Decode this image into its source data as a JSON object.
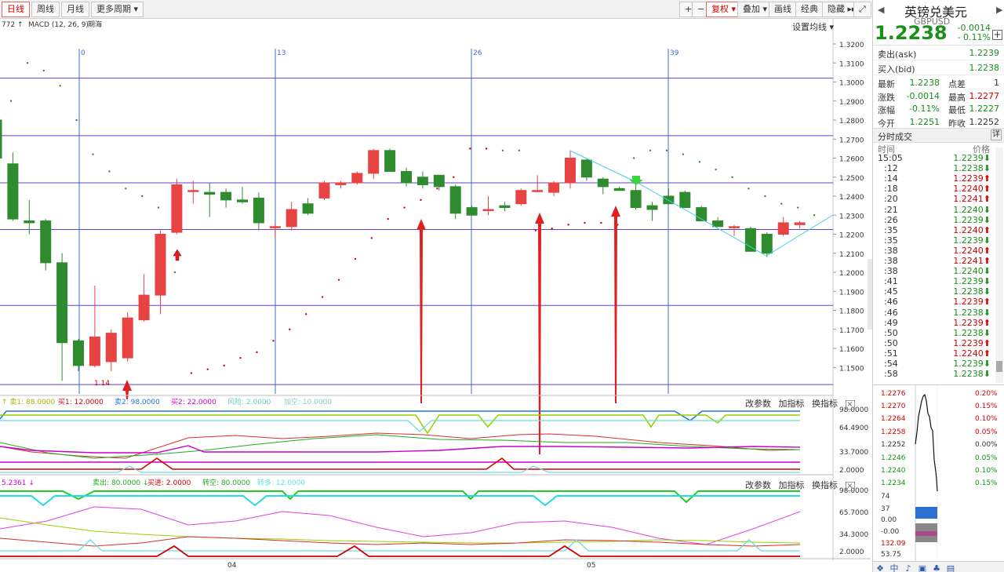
{
  "toolbar": {
    "left_tabs": [
      "日线",
      "周线",
      "月线",
      "更多周期 ▾"
    ],
    "right_buttons": [
      "+",
      "−",
      "复权 ▾",
      "叠加 ▾",
      "画线",
      "经典",
      "隐藏 ▸▸",
      "⤢"
    ]
  },
  "main_panel": {
    "indicator_tag": "772 ↑",
    "macd_label": "MACD (12, 26, 9)",
    "extra_label": "期海",
    "settings_label": "设置均线 ▾",
    "month_labels": [
      "0",
      "13",
      "26",
      "39"
    ],
    "y_ticks": [
      "1.3200",
      "1.3100",
      "1.3000",
      "1.2900",
      "1.2800",
      "1.2700",
      "1.2600",
      "1.2500",
      "1.2400",
      "1.2300",
      "1.2200",
      "1.2100",
      "1.2000",
      "1.1900",
      "1.1800",
      "1.1700",
      "1.1600",
      "1.1500"
    ],
    "low_marker": "1.14"
  },
  "panel2": {
    "legend": [
      {
        "text": "↑ 卖1: 88.0000",
        "color": "#b0b000"
      },
      {
        "text": "买1: 12.0000",
        "color": "#d40000"
      },
      {
        "text": "卖2: 98.0000",
        "color": "#2277dd"
      },
      {
        "text": "买2: 22.0000",
        "color": "#cc00cc"
      },
      {
        "text": "风险: 2.0000",
        "color": "#66cccc"
      },
      {
        "text": "加空: 10.0000",
        "color": "#88cccc"
      }
    ],
    "tools": [
      "改参数",
      "加指标",
      "换指标"
    ],
    "y_ticks": [
      "98.0000",
      "64.4900",
      "33.7000",
      "2.0000"
    ]
  },
  "panel3": {
    "left_value": "5.2361 ↓",
    "legend": [
      {
        "text": "卖出: 80.0000 ↓",
        "color": "#22aa22"
      },
      {
        "text": "买进: 2.0000",
        "color": "#d40000"
      },
      {
        "text": "转空: 80.0000",
        "color": "#22aa22"
      },
      {
        "text": "转多: 12.0000",
        "color": "#66dddd"
      }
    ],
    "tools": [
      "改参数",
      "加指标",
      "换指标"
    ],
    "y_ticks": [
      "98.0000",
      "65.7000",
      "34.3000",
      "2.0000"
    ]
  },
  "x_axis_labels": [
    "04",
    "05"
  ],
  "side": {
    "nav_left": "◀",
    "nav_right": "▶",
    "title": "英镑兑美元",
    "code": "GBPUSD",
    "price": "1.2238",
    "change": "-0.0014",
    "change_pct": "- 0.11%",
    "plus": "+",
    "ask_label": "卖出(ask)",
    "ask_value": "1.2239",
    "bid_label": "买入(bid)",
    "bid_value": "1.2238",
    "quote": [
      [
        "最新",
        "1.2238",
        "点差",
        "1"
      ],
      [
        "涨跌",
        "-0.0014",
        "最高",
        "1.2277"
      ],
      [
        "涨幅",
        "-0.11%",
        "最低",
        "1.2227"
      ],
      [
        "今开",
        "1.2251",
        "昨收",
        "1.2252"
      ]
    ],
    "ticks_title": "分时成交",
    "ticks_detail": "详",
    "col_time": "时间",
    "col_price": "价格",
    "ticks": [
      [
        "15:05",
        "1.2239",
        "down"
      ],
      [
        ":12",
        "1.2238",
        "down"
      ],
      [
        ":14",
        "1.2239",
        "up"
      ],
      [
        ":18",
        "1.2240",
        "up"
      ],
      [
        ":20",
        "1.2241",
        "up"
      ],
      [
        ":21",
        "1.2240",
        "down"
      ],
      [
        ":26",
        "1.2239",
        "down"
      ],
      [
        ":35",
        "1.2240",
        "up"
      ],
      [
        ":35",
        "1.2239",
        "down"
      ],
      [
        ":38",
        "1.2240",
        "up"
      ],
      [
        ":38",
        "1.2241",
        "up"
      ],
      [
        ":38",
        "1.2240",
        "down"
      ],
      [
        ":41",
        "1.2239",
        "down"
      ],
      [
        ":45",
        "1.2238",
        "down"
      ],
      [
        ":46",
        "1.2239",
        "up"
      ],
      [
        ":46",
        "1.2238",
        "down"
      ],
      [
        ":49",
        "1.2239",
        "up"
      ],
      [
        ":50",
        "1.2238",
        "down"
      ],
      [
        ":50",
        "1.2239",
        "up"
      ],
      [
        ":51",
        "1.2240",
        "up"
      ],
      [
        ":54",
        "1.2239",
        "down"
      ],
      [
        ":58",
        "1.2238",
        "down"
      ]
    ],
    "mini_left": [
      "1.2276",
      "1.2270",
      "1.2264",
      "1.2258",
      "1.2252",
      "1.2246",
      "1.2240",
      "1.2234",
      "74",
      "37",
      "0.00",
      "-0.00",
      "132.09",
      "53.75"
    ],
    "mini_right": [
      "0.20%",
      "0.15%",
      "0.10%",
      "0.05%",
      "0.00%",
      "0.05%",
      "0.10%",
      "0.15%"
    ],
    "bottom_icons": [
      "❖",
      "中",
      "♪",
      "▣",
      "♣",
      "▤"
    ]
  },
  "chart_data": {
    "type": "candlestick",
    "symbol": "GBPUSD",
    "ylim": [
      1.14,
      1.325
    ],
    "candles": [
      {
        "o": 1.28,
        "h": 1.288,
        "l": 1.258,
        "c": 1.26
      },
      {
        "o": 1.257,
        "h": 1.263,
        "l": 1.227,
        "c": 1.228
      },
      {
        "o": 1.227,
        "h": 1.238,
        "l": 1.22,
        "c": 1.226
      },
      {
        "o": 1.227,
        "h": 1.228,
        "l": 1.201,
        "c": 1.205
      },
      {
        "o": 1.205,
        "h": 1.21,
        "l": 1.143,
        "c": 1.163
      },
      {
        "o": 1.164,
        "h": 1.165,
        "l": 1.148,
        "c": 1.151
      },
      {
        "o": 1.151,
        "h": 1.193,
        "l": 1.15,
        "c": 1.166
      },
      {
        "o": 1.153,
        "h": 1.17,
        "l": 1.148,
        "c": 1.168
      },
      {
        "o": 1.155,
        "h": 1.179,
        "l": 1.153,
        "c": 1.176
      },
      {
        "o": 1.175,
        "h": 1.199,
        "l": 1.174,
        "c": 1.188
      },
      {
        "o": 1.188,
        "h": 1.222,
        "l": 1.178,
        "c": 1.22
      },
      {
        "o": 1.221,
        "h": 1.249,
        "l": 1.22,
        "c": 1.246
      },
      {
        "o": 1.243,
        "h": 1.248,
        "l": 1.236,
        "c": 1.243
      },
      {
        "o": 1.242,
        "h": 1.247,
        "l": 1.229,
        "c": 1.241
      },
      {
        "o": 1.242,
        "h": 1.244,
        "l": 1.234,
        "c": 1.238
      },
      {
        "o": 1.238,
        "h": 1.245,
        "l": 1.236,
        "c": 1.237
      },
      {
        "o": 1.239,
        "h": 1.242,
        "l": 1.222,
        "c": 1.226
      },
      {
        "o": 1.224,
        "h": 1.226,
        "l": 1.218,
        "c": 1.224
      },
      {
        "o": 1.224,
        "h": 1.237,
        "l": 1.222,
        "c": 1.233
      },
      {
        "o": 1.236,
        "h": 1.239,
        "l": 1.23,
        "c": 1.231
      },
      {
        "o": 1.239,
        "h": 1.248,
        "l": 1.238,
        "c": 1.247
      },
      {
        "o": 1.246,
        "h": 1.248,
        "l": 1.244,
        "c": 1.247
      },
      {
        "o": 1.247,
        "h": 1.253,
        "l": 1.246,
        "c": 1.252
      },
      {
        "o": 1.252,
        "h": 1.265,
        "l": 1.249,
        "c": 1.264
      },
      {
        "o": 1.264,
        "h": 1.265,
        "l": 1.254,
        "c": 1.253
      },
      {
        "o": 1.253,
        "h": 1.255,
        "l": 1.245,
        "c": 1.247
      },
      {
        "o": 1.25,
        "h": 1.253,
        "l": 1.244,
        "c": 1.246
      },
      {
        "o": 1.251,
        "h": 1.251,
        "l": 1.243,
        "c": 1.245
      },
      {
        "o": 1.245,
        "h": 1.246,
        "l": 1.228,
        "c": 1.231
      },
      {
        "o": 1.234,
        "h": 1.235,
        "l": 1.23,
        "c": 1.23
      },
      {
        "o": 1.233,
        "h": 1.24,
        "l": 1.23,
        "c": 1.233
      },
      {
        "o": 1.235,
        "h": 1.237,
        "l": 1.232,
        "c": 1.234
      },
      {
        "o": 1.236,
        "h": 1.244,
        "l": 1.235,
        "c": 1.243
      },
      {
        "o": 1.243,
        "h": 1.251,
        "l": 1.242,
        "c": 1.243
      },
      {
        "o": 1.242,
        "h": 1.248,
        "l": 1.24,
        "c": 1.247
      },
      {
        "o": 1.247,
        "h": 1.264,
        "l": 1.244,
        "c": 1.26
      },
      {
        "o": 1.259,
        "h": 1.26,
        "l": 1.248,
        "c": 1.25
      },
      {
        "o": 1.249,
        "h": 1.25,
        "l": 1.241,
        "c": 1.245
      },
      {
        "o": 1.244,
        "h": 1.245,
        "l": 1.243,
        "c": 1.243
      },
      {
        "o": 1.243,
        "h": 1.246,
        "l": 1.233,
        "c": 1.234
      },
      {
        "o": 1.235,
        "h": 1.237,
        "l": 1.227,
        "c": 1.233
      },
      {
        "o": 1.24,
        "h": 1.244,
        "l": 1.236,
        "c": 1.236
      },
      {
        "o": 1.242,
        "h": 1.243,
        "l": 1.234,
        "c": 1.234
      },
      {
        "o": 1.234,
        "h": 1.235,
        "l": 1.227,
        "c": 1.227
      },
      {
        "o": 1.227,
        "h": 1.229,
        "l": 1.224,
        "c": 1.224
      },
      {
        "o": 1.224,
        "h": 1.225,
        "l": 1.219,
        "c": 1.224
      },
      {
        "o": 1.223,
        "h": 1.224,
        "l": 1.211,
        "c": 1.211
      },
      {
        "o": 1.22,
        "h": 1.221,
        "l": 1.208,
        "c": 1.21
      },
      {
        "o": 1.22,
        "h": 1.229,
        "l": 1.219,
        "c": 1.226
      },
      {
        "o": 1.225,
        "h": 1.227,
        "l": 1.223,
        "c": 1.226
      }
    ],
    "sar": [
      1.29,
      1.31,
      1.306,
      1.298,
      1.28,
      1.262,
      1.253,
      1.244,
      1.24,
      1.234,
      1.2,
      1.147,
      1.149,
      1.151,
      1.155,
      1.158,
      1.164,
      1.17,
      1.178,
      1.187,
      1.196,
      1.207,
      1.218,
      1.228,
      1.234,
      1.238,
      1.244,
      1.25,
      1.265,
      1.265,
      1.264,
      1.264,
      1.222,
      1.223,
      1.225,
      1.226,
      1.226,
      1.225,
      1.26,
      1.264,
      1.264,
      1.262,
      1.258,
      1.254,
      1.25,
      1.244,
      1.24,
      1.236,
      1.234,
      1.23
    ],
    "horizontal_levels": [
      1.302,
      1.2718,
      1.247,
      1.2225,
      1.1826,
      1.141
    ]
  }
}
